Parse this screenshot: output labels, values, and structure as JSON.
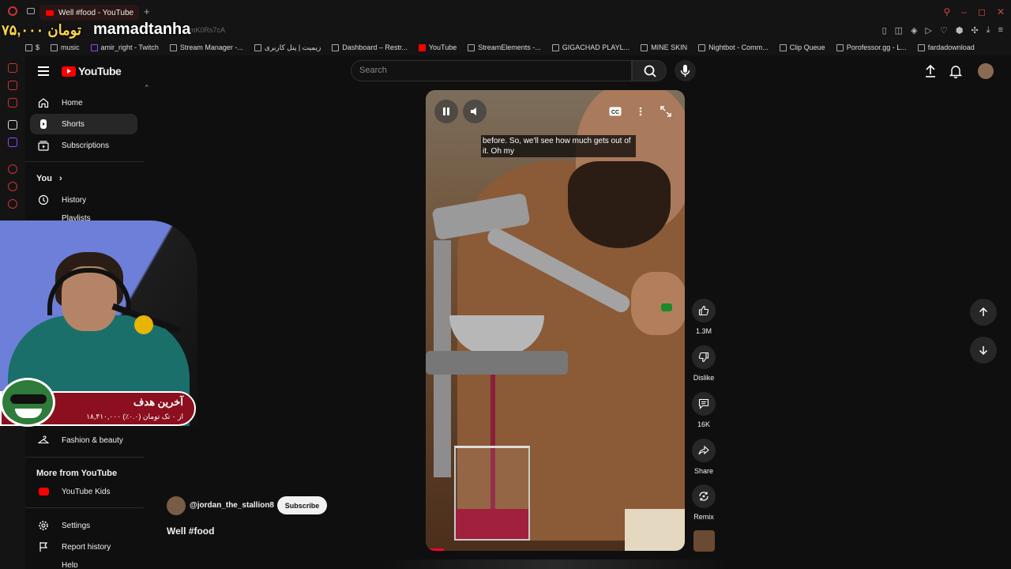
{
  "browser": {
    "tab_title": "Well #food - YouTube",
    "url_fragment": "mK0Rs7cA",
    "bookmarks": [
      {
        "label": "$"
      },
      {
        "label": "music"
      },
      {
        "label": "amir_right - Twitch"
      },
      {
        "label": "Stream Manager -..."
      },
      {
        "label": "زیمیت | پنل کاربری"
      },
      {
        "label": "Dashboard – Restr..."
      },
      {
        "label": "YouTube"
      },
      {
        "label": "StreamElements -..."
      },
      {
        "label": "GIGACHAD PLAYL..."
      },
      {
        "label": "MINE SKIN"
      },
      {
        "label": "Nightbot - Comm..."
      },
      {
        "label": "Clip Queue"
      },
      {
        "label": "Porofessor.gg - L..."
      },
      {
        "label": "fardadownload"
      }
    ]
  },
  "stream_overlay": {
    "donor_name": "mamadtanha",
    "donation_amount": "۷۵,۰۰۰ تومان",
    "goal_title": "آخرین هدف",
    "goal_subtitle": "۱۸,۴۱۰,۰۰۰ از ۰ تک تومان (۰.۰٪)"
  },
  "header": {
    "logo_text": "YouTube",
    "search_placeholder": "Search"
  },
  "sidebar": {
    "items": [
      {
        "label": "Home"
      },
      {
        "label": "Shorts"
      },
      {
        "label": "Subscriptions"
      }
    ],
    "you_heading": "You",
    "you_items": [
      {
        "label": "History"
      },
      {
        "label": "Playlists"
      }
    ],
    "explore_items": [
      {
        "label": "Fashion & beauty"
      }
    ],
    "more_heading": "More from YouTube",
    "more_items": [
      {
        "label": "YouTube Kids"
      }
    ],
    "footer_items": [
      {
        "label": "Settings"
      },
      {
        "label": "Report history"
      },
      {
        "label": "Help"
      }
    ]
  },
  "video": {
    "caption": "before. So, we'll see how much gets out of it. Oh my",
    "progress": 0.07
  },
  "actions": {
    "like_count": "1.3M",
    "dislike_label": "Dislike",
    "comment_count": "16K",
    "share_label": "Share",
    "remix_label": "Remix"
  },
  "channel": {
    "handle": "@jordan_the_stallion8",
    "subscribe_label": "Subscribe",
    "video_title": "Well #food"
  },
  "colors": {
    "accent": "#ff0000",
    "background": "#0f0f0f"
  }
}
